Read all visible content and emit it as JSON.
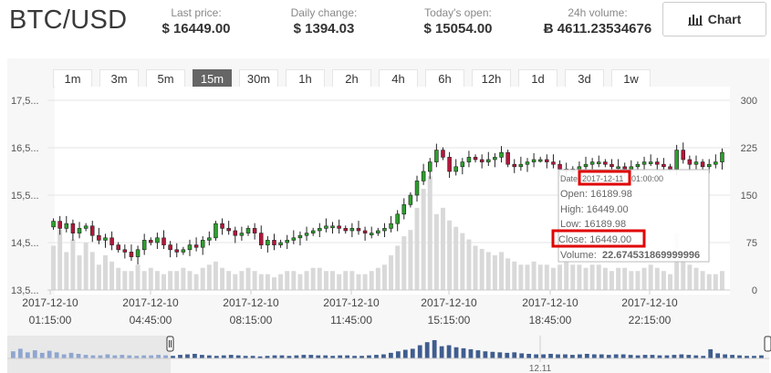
{
  "header": {
    "pair": "BTC/USD",
    "stats": [
      {
        "label": "Last price:",
        "value": "$ 16449.00"
      },
      {
        "label": "Daily change:",
        "value": "$ 1394.03"
      },
      {
        "label": "Today's open:",
        "value": "$ 15054.00"
      },
      {
        "label": "24h volume:",
        "value": "Ƀ 4611.23534676"
      }
    ],
    "chart_button": "Chart"
  },
  "ranges": [
    "1m",
    "3m",
    "5m",
    "15m",
    "30m",
    "1h",
    "2h",
    "4h",
    "6h",
    "12h",
    "1d",
    "3d",
    "1w"
  ],
  "active_range": "15m",
  "tooltip": {
    "date_label": "Date",
    "date_value": "2017-12-11",
    "time_value": "01:00:00",
    "open": "Open: 16189.98",
    "high": "High: 16449.00",
    "low": "Low: 16189.98",
    "close": "Close: 16449.00",
    "volume_label": "Volume:",
    "volume_value": "22.674531869999996"
  },
  "navigator_label": "12.11",
  "colors": {
    "up": "#2ca02c",
    "down": "#b5153a",
    "highlight": "#e00000"
  },
  "chart_data": {
    "type": "candlestick",
    "y_ticks": [
      "17,5...",
      "16,5...",
      "15,5...",
      "14,5...",
      "13,5..."
    ],
    "y2_ticks": [
      "300",
      "225",
      "150",
      "75",
      "0"
    ],
    "ylim": [
      13500,
      17500
    ],
    "y2lim": [
      0,
      300
    ],
    "x_ticks": [
      {
        "date": "2017-12-10",
        "time": "01:15:00"
      },
      {
        "date": "2017-12-10",
        "time": "04:45:00"
      },
      {
        "date": "2017-12-10",
        "time": "08:15:00"
      },
      {
        "date": "2017-12-10",
        "time": "11:45:00"
      },
      {
        "date": "2017-12-10",
        "time": "15:15:00"
      },
      {
        "date": "2017-12-10",
        "time": "18:45:00"
      },
      {
        "date": "2017-12-10",
        "time": "22:15:00"
      }
    ],
    "close": [
      14950,
      14800,
      14900,
      14700,
      14800,
      14850,
      14650,
      14550,
      14600,
      14450,
      14350,
      14300,
      14200,
      14350,
      14550,
      14500,
      14600,
      14450,
      14350,
      14300,
      14350,
      14450,
      14400,
      14550,
      14600,
      14900,
      14800,
      14750,
      14650,
      14700,
      14800,
      14700,
      14450,
      14550,
      14450,
      14500,
      14550,
      14600,
      14650,
      14700,
      14750,
      14800,
      14850,
      14850,
      14800,
      14750,
      14800,
      14750,
      14700,
      14700,
      14750,
      14800,
      14900,
      15100,
      15300,
      15500,
      15800,
      16000,
      16200,
      16450,
      16300,
      16000,
      16100,
      16200,
      16300,
      16250,
      16200,
      16250,
      16300,
      16400,
      16150,
      16100,
      16150,
      16200,
      16250,
      16250,
      16200,
      16150,
      16050,
      16000,
      16050,
      16100,
      16150,
      16200,
      16200,
      16150,
      16100,
      16100,
      16050,
      16100,
      16150,
      16200,
      16200,
      16150,
      16100,
      16050,
      16450,
      16250,
      16150,
      16200,
      16100,
      16150,
      16200,
      16400
    ],
    "volume": [
      70,
      95,
      60,
      80,
      55,
      75,
      60,
      40,
      55,
      45,
      35,
      30,
      30,
      40,
      30,
      35,
      30,
      25,
      30,
      30,
      35,
      30,
      25,
      35,
      40,
      45,
      35,
      30,
      25,
      30,
      35,
      30,
      25,
      25,
      20,
      25,
      30,
      30,
      25,
      30,
      35,
      35,
      30,
      30,
      25,
      30,
      30,
      25,
      25,
      30,
      35,
      40,
      55,
      70,
      85,
      95,
      130,
      160,
      180,
      120,
      130,
      110,
      100,
      90,
      80,
      70,
      65,
      60,
      55,
      60,
      50,
      45,
      40,
      40,
      45,
      40,
      40,
      35,
      40,
      45,
      40,
      40,
      35,
      40,
      40,
      35,
      30,
      35,
      35,
      30,
      30,
      35,
      40,
      35,
      30,
      25,
      90,
      50,
      40,
      35,
      30,
      25,
      25,
      30
    ],
    "volume_unit": "BTC"
  }
}
